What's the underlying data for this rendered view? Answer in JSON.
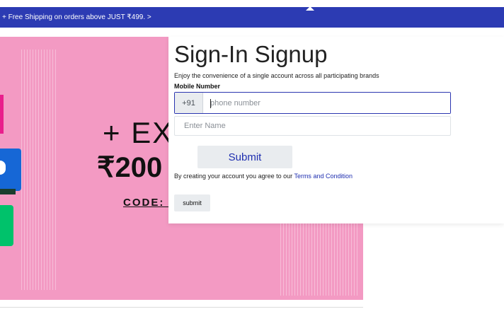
{
  "announcement": {
    "text": "+ Free Shipping on orders above JUST ₹499. >"
  },
  "banner": {
    "headline": "+ EX",
    "amount": "₹200",
    "code": "CODE: N"
  },
  "signin": {
    "title": "Sign-In Signup",
    "subtitle": "Enjoy the convenience of a single account across all participating brands",
    "mobile_label": "Mobile Number",
    "country_code": "+91",
    "phone_placeholder": "phone number",
    "phone_value": "",
    "name_placeholder": "Enter Name",
    "name_value": "",
    "submit_label": "Submit",
    "terms_prefix": "By creating your account you agree to our ",
    "terms_link": "Terms and Condition",
    "submit_small_label": "submit"
  },
  "colors": {
    "topbar": "#2c3bb3",
    "banner": "#f39ac3",
    "accent": "#1f2fb0"
  }
}
